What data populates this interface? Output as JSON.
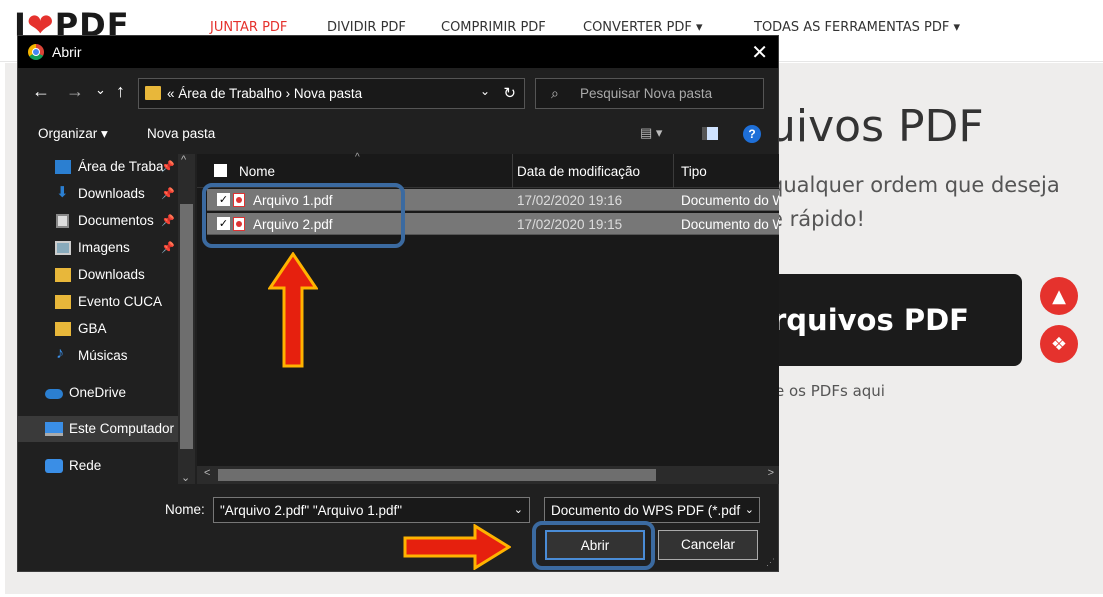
{
  "site": {
    "logo_prefix": "I",
    "logo_heart": "❤",
    "logo_suffix": "PDF",
    "nav": [
      {
        "label": "JUNTAR PDF"
      },
      {
        "label": "DIVIDIR PDF"
      },
      {
        "label": "COMPRIMIR PDF"
      },
      {
        "label": "CONVERTER PDF ▾"
      },
      {
        "label": "TODAS AS FERRAMENTAS PDF ▾"
      }
    ],
    "hero_title": "uivos PDF",
    "hero_sub_1": "qualquer ordem que deseja",
    "hero_sub_2": "e rápido!",
    "select_btn_label": "rquivos PDF",
    "drop_hint": "e os PDFs aqui",
    "brand_color": "#e5322d"
  },
  "dialog": {
    "title": "Abrir",
    "close": "✕",
    "nav": {
      "back": "←",
      "forward": "→",
      "recent": "⌄",
      "up": "↑"
    },
    "address": {
      "path": "« Área de Trabalho › Nova pasta",
      "dropdown": "⌄",
      "refresh": "↻"
    },
    "search": {
      "icon": "⌕",
      "placeholder": "Pesquisar Nova pasta"
    },
    "toolbar": {
      "organize": "Organizar ▾",
      "new_folder": "Nova pasta",
      "view": "▤ ▾",
      "help": "?"
    },
    "sidebar": [
      {
        "label": "Área de Traba",
        "icon": "desktop-icon",
        "pinned": true
      },
      {
        "label": "Downloads",
        "icon": "download-icon",
        "pinned": true
      },
      {
        "label": "Documentos",
        "icon": "documents-icon",
        "pinned": true
      },
      {
        "label": "Imagens",
        "icon": "pictures-icon",
        "pinned": true
      },
      {
        "label": "Downloads",
        "icon": "folder-icon",
        "pinned": false
      },
      {
        "label": "Evento CUCA",
        "icon": "folder-icon",
        "pinned": false
      },
      {
        "label": "GBA",
        "icon": "folder-icon",
        "pinned": false
      },
      {
        "label": "Músicas",
        "icon": "music-icon",
        "pinned": false
      },
      {
        "label": "OneDrive",
        "icon": "cloud-icon",
        "pinned": false
      },
      {
        "label": "Este Computador",
        "icon": "computer-icon",
        "pinned": false
      },
      {
        "label": "Rede",
        "icon": "network-icon",
        "pinned": false
      }
    ],
    "pin_glyph": "📌",
    "columns": {
      "name": "Nome",
      "date": "Data de modificação",
      "type": "Tipo"
    },
    "files": [
      {
        "name": "Arquivo 1.pdf",
        "date": "17/02/2020 19:16",
        "type": "Documento do WPS PDF",
        "checked": "✓"
      },
      {
        "name": "Arquivo 2.pdf",
        "date": "17/02/2020 19:15",
        "type": "Documento do WPS PDF",
        "checked": "✓"
      }
    ],
    "filename_label": "Nome:",
    "filename_value": "\"Arquivo 2.pdf\" \"Arquivo 1.pdf\"",
    "filetype_value": "Documento do WPS PDF (*.pdf",
    "open_label": "Abrir",
    "cancel_label": "Cancelar"
  }
}
